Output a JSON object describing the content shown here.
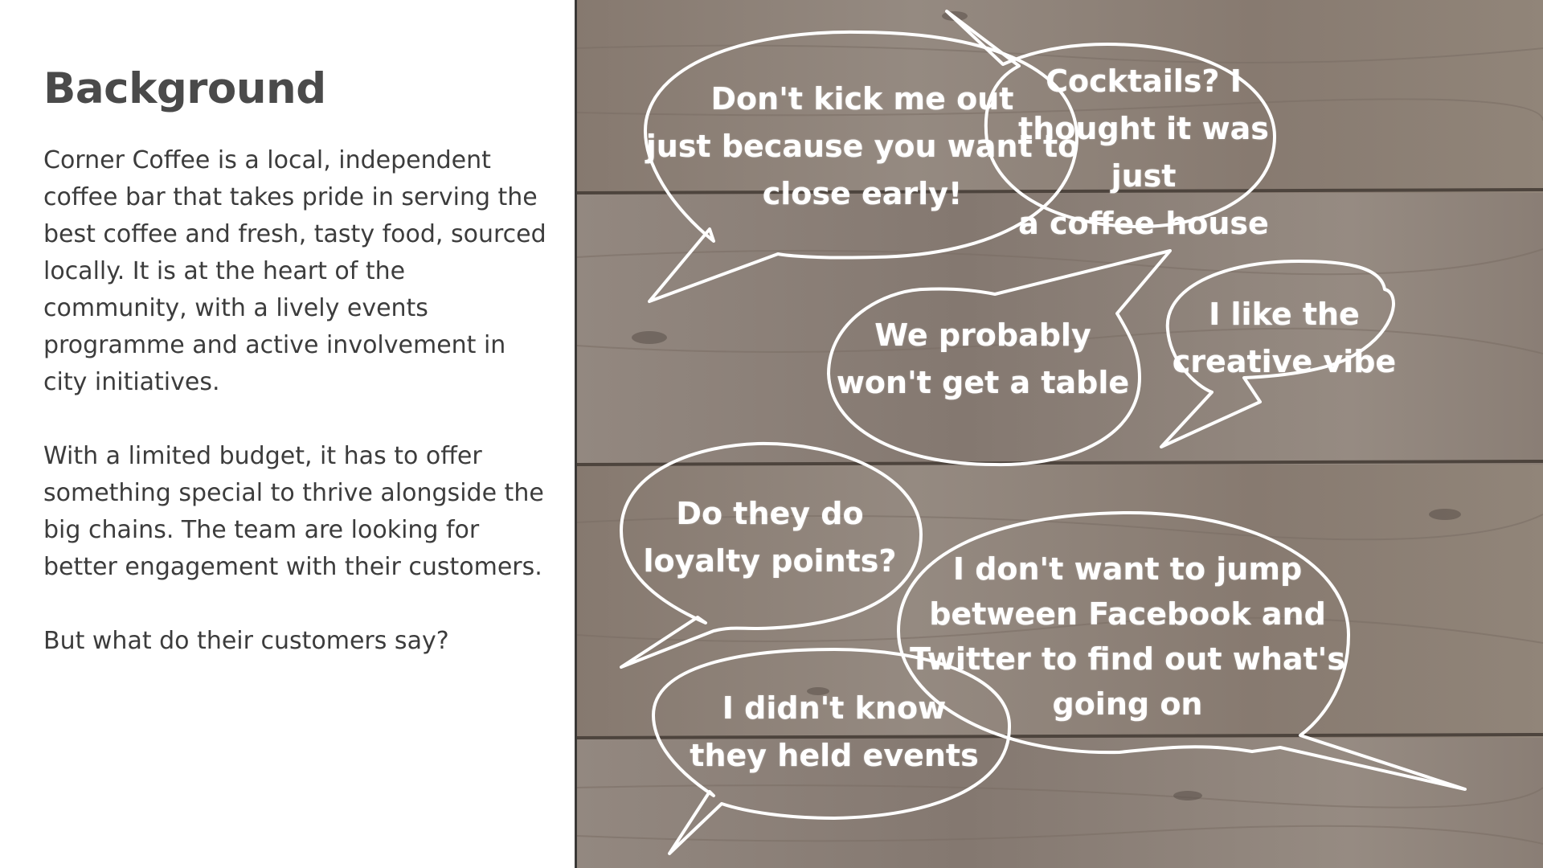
{
  "slide": {
    "title": "Background",
    "paragraphs": [
      "Corner Coffee is a local, independent coffee bar that takes pride in serving the best coffee and fresh, tasty food, sourced locally.  It is at the heart of the community, with a lively events programme and active involvement in city initiatives.",
      "With a limited budget, it has to offer something special to thrive alongside the big chains.  The team are looking for better engagement with their customers.",
      "But what do their customers say?"
    ]
  },
  "speech_bubbles": [
    {
      "id": "close-early",
      "text": "Don't kick me out\njust because you want to\nclose early!"
    },
    {
      "id": "cocktails",
      "text": "Cocktails? I\nthought it was just\na coffee house"
    },
    {
      "id": "table",
      "text": "We probably\nwon't get a table"
    },
    {
      "id": "creative-vibe",
      "text": "I like the\ncreative vibe"
    },
    {
      "id": "loyalty",
      "text": "Do they do\nloyalty points?"
    },
    {
      "id": "facebook-twitter",
      "text": "I don't want to jump\nbetween Facebook and\nTwitter to find out what's\ngoing on"
    },
    {
      "id": "events",
      "text": "I didn't know\nthey held events"
    }
  ],
  "colors": {
    "title": "#4a4a4a",
    "body_text": "#3c3c3c",
    "wood_base": "#8d8178",
    "chalk": "#ffffff"
  }
}
